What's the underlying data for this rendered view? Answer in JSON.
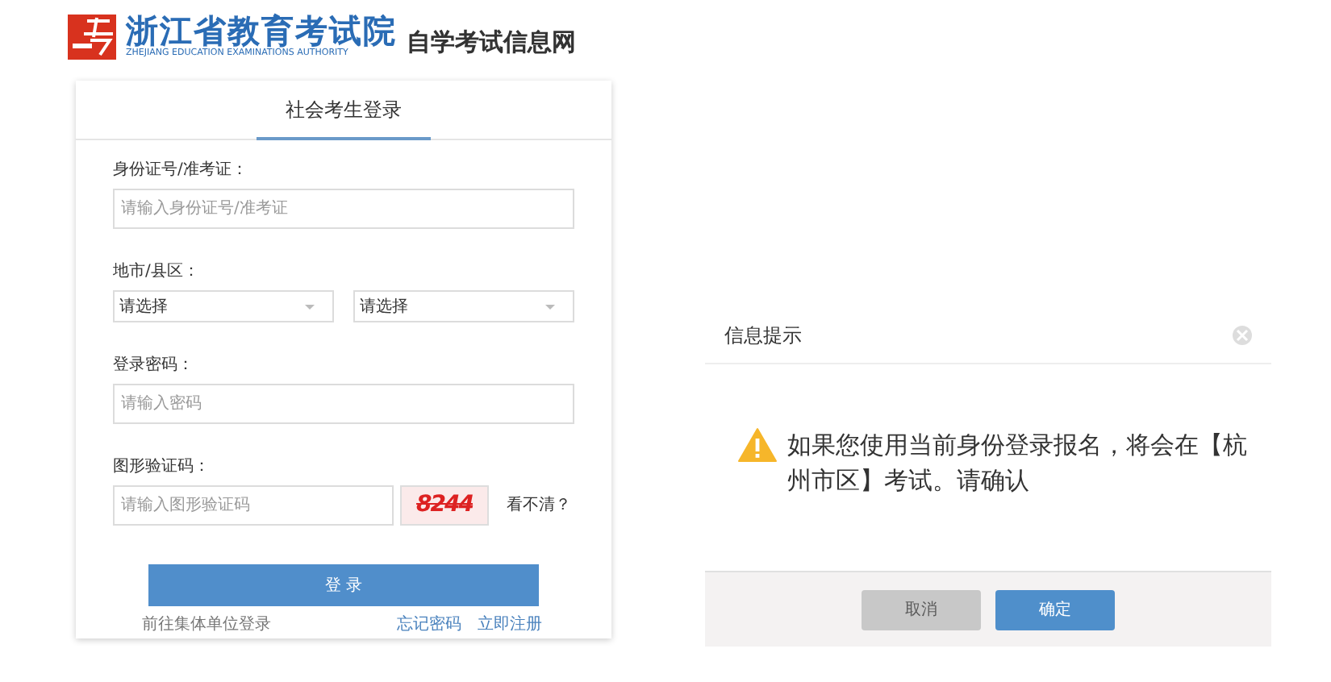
{
  "header": {
    "title": "浙江省教育考试院",
    "subtitle": "ZHEJIANG EDUCATION EXAMINATIONS AUTHORITY",
    "site_name": "自学考试信息网"
  },
  "login": {
    "tabs": [
      {
        "label": "社会考生登录",
        "selected": true
      }
    ],
    "fields": [
      {
        "kind": "input",
        "label": "身份证号/准考证：",
        "placeholder": "请输入身份证号/准考证"
      },
      {
        "kind": "selects",
        "label": "地市/县区：",
        "values": [
          "请选择",
          "请选择"
        ]
      },
      {
        "kind": "input",
        "label": "登录密码：",
        "placeholder": "请输入密码"
      },
      {
        "kind": "captcha",
        "label": "图形验证码：",
        "placeholder": "请输入图形验证码",
        "code": "8244",
        "refresh": "看不清？"
      }
    ],
    "submit": "登 录",
    "group_link": "前往集体单位登录",
    "forgot_link": "忘记密码",
    "register_link": "立即注册"
  },
  "dialog": {
    "title": "信息提示",
    "message": "如果您使用当前身份登录报名，将会在【杭州市区】考试。请确认",
    "buttons": [
      {
        "label": "取消",
        "kind": "secondary"
      },
      {
        "label": "确定",
        "kind": "primary"
      }
    ]
  }
}
